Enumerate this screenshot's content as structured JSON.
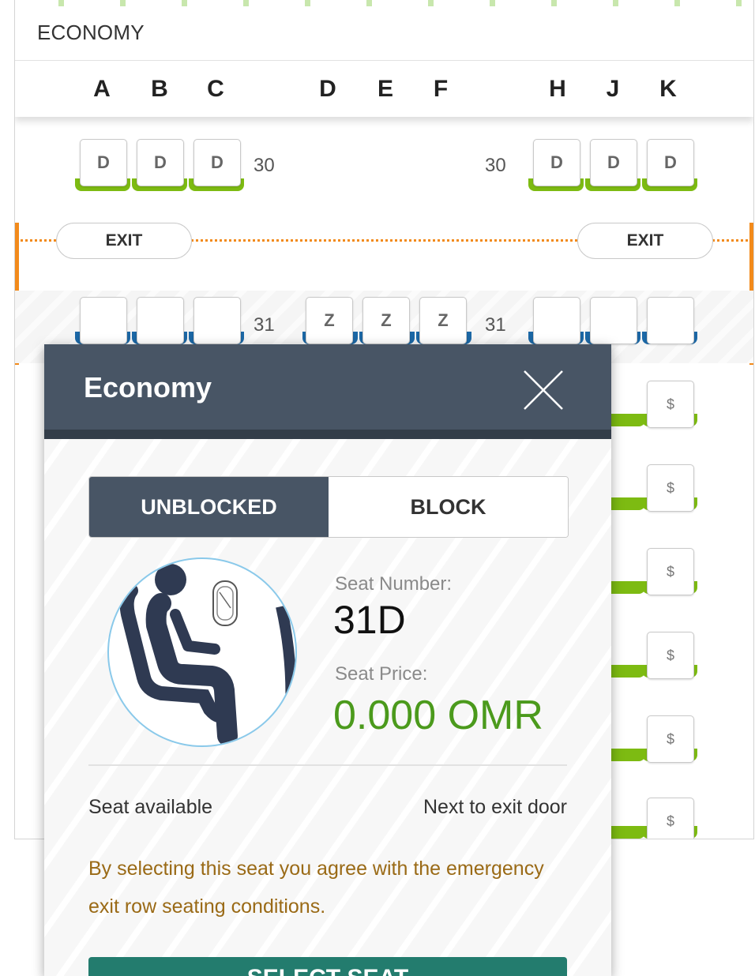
{
  "cabin": {
    "label": "ECONOMY"
  },
  "columns": [
    "A",
    "B",
    "C",
    "D",
    "E",
    "F",
    "H",
    "J",
    "K"
  ],
  "rows": [
    {
      "number": "30",
      "left": [
        "D",
        "D",
        "D"
      ],
      "middle": [],
      "right": [
        "D",
        "D",
        "D"
      ],
      "color": "#7dbb12"
    },
    {
      "number": "31",
      "left": [
        "",
        "",
        ""
      ],
      "middle": [
        "Z",
        "Z",
        "Z"
      ],
      "right": [
        "",
        "",
        ""
      ],
      "color": "#1c68a6"
    }
  ],
  "exit": {
    "left_label": "EXIT",
    "right_label": "EXIT",
    "color": "#f28a1b"
  },
  "right_column_seats": [
    "$",
    "$",
    "$",
    "$",
    "$",
    "$"
  ],
  "popup": {
    "title": "Economy",
    "toggle": {
      "unblocked_label": "UNBLOCKED",
      "block_label": "BLOCK",
      "active": "UNBLOCKED"
    },
    "seat_number_label": "Seat Number:",
    "seat_number": "31D",
    "seat_price_label": "Seat Price:",
    "seat_price": "0.000 OMR",
    "status": "Seat available",
    "feature": "Next to exit door",
    "agreement": "By selecting this seat you agree with the emergency exit row seating conditions.",
    "select_button": "SELECT SEAT",
    "image_icon": "seated-passenger-icon",
    "close_icon": "close-icon"
  },
  "colors": {
    "header": "#485565",
    "price": "#4b9a1c",
    "button": "#237c6e",
    "available": "#7dbb12",
    "selected_row": "#1c68a6"
  }
}
